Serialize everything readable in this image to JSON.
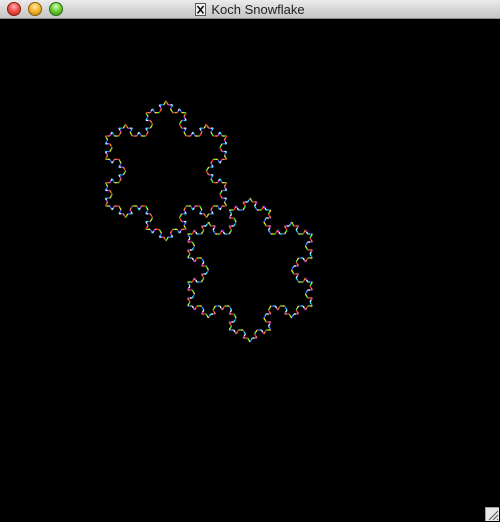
{
  "window": {
    "title": "Koch Snowflake"
  },
  "buttons": {
    "close": "close",
    "minimize": "minimize",
    "zoom": "zoom"
  },
  "icons": {
    "document": "x11-document-icon",
    "resize": "resize-grip-icon"
  },
  "drawing": {
    "background": "#000000",
    "snowflake_count": 2,
    "recursion_depth": 3,
    "palette": [
      "#ff2a2a",
      "#ff9a1f",
      "#ffe81f",
      "#3cff3c",
      "#2ad9ff",
      "#3a5bff",
      "#c03aff",
      "#ffffff"
    ]
  }
}
